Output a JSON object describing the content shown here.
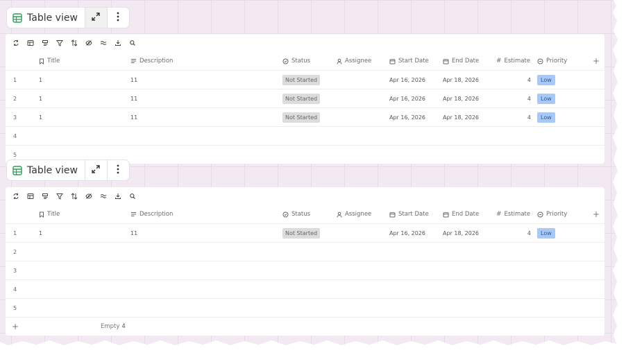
{
  "views": [
    {
      "title": "Table view",
      "columns": {
        "title": "Title",
        "description": "Description",
        "status": "Status",
        "assignee": "Assignee",
        "start_date": "Start Date",
        "end_date": "End Date",
        "estimate": "Estimate",
        "priority": "Priority",
        "add": "+"
      },
      "rows": [
        {
          "num": "1",
          "title": "1",
          "description": "11",
          "status": "Not Started",
          "assignee": "",
          "start_date": "Apr 16, 2026",
          "end_date": "Apr 18, 2026",
          "estimate": "4",
          "priority": "Low"
        },
        {
          "num": "2",
          "title": "1",
          "description": "11",
          "status": "Not Started",
          "assignee": "",
          "start_date": "Apr 16, 2026",
          "end_date": "Apr 18, 2026",
          "estimate": "4",
          "priority": "Low"
        },
        {
          "num": "3",
          "title": "1",
          "description": "11",
          "status": "Not Started",
          "assignee": "",
          "start_date": "Apr 16, 2026",
          "end_date": "Apr 18, 2026",
          "estimate": "4",
          "priority": "Low"
        },
        {
          "num": "4"
        },
        {
          "num": "5"
        }
      ]
    },
    {
      "title": "Table view",
      "columns": {
        "title": "Title",
        "description": "Description",
        "status": "Status",
        "assignee": "Assignee",
        "start_date": "Start Date",
        "end_date": "End Date",
        "estimate": "Estimate",
        "priority": "Priority",
        "add": "+"
      },
      "rows": [
        {
          "num": "1",
          "title": "1",
          "description": "11",
          "status": "Not Started",
          "assignee": "",
          "start_date": "Apr 16, 2026",
          "end_date": "Apr 18, 2026",
          "estimate": "4",
          "priority": "Low"
        },
        {
          "num": "2"
        },
        {
          "num": "3"
        },
        {
          "num": "4"
        },
        {
          "num": "5"
        }
      ],
      "footer": {
        "add": "+",
        "empty_label": "Empty",
        "empty_count": "4"
      }
    }
  ],
  "colors": {
    "canvas": "#f2e9f3",
    "status_pill": "#dcdcdc",
    "priority_low": "#a8c9f5",
    "table_icon": "#2e9e5b"
  },
  "icons": {
    "header": [
      "table-icon",
      "expand-icon",
      "more-vertical-icon"
    ],
    "toolbar": [
      "sync-icon",
      "layout-icon",
      "group-icon",
      "filter-icon",
      "sort-icon",
      "hide-icon",
      "adjust-icon",
      "download-icon",
      "search-icon"
    ],
    "columns": [
      "bookmark-icon",
      "text-lines-icon",
      "status-circle-icon",
      "person-icon",
      "calendar-icon",
      "calendar-icon",
      "hash-icon",
      "priority-circle-icon"
    ]
  }
}
